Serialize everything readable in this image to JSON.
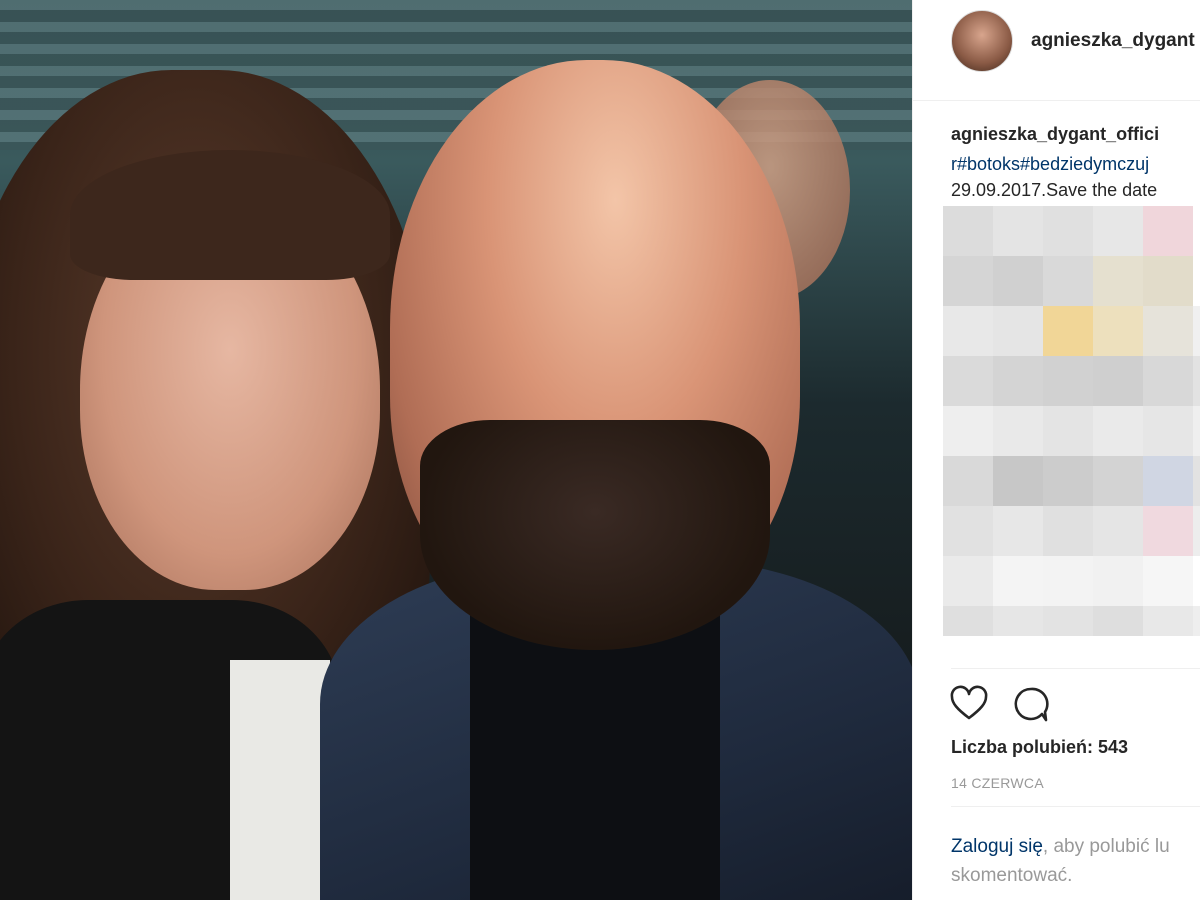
{
  "post": {
    "username": "agnieszka_dygant",
    "caption_username": "agnieszka_dygant_offici",
    "hashtags": "r#botoks#bedziedymczuj",
    "date_line": "29.09.2017.Save the date"
  },
  "actions": {
    "like_icon": "heart-outline-icon",
    "comment_icon": "speech-bubble-icon"
  },
  "likes_text": "Liczba polubień: 543",
  "post_date": "14 CZERWCA",
  "login": {
    "link_text": "Zaloguj się",
    "rest_text": ", aby polubić lu",
    "second_line": "skomentować."
  },
  "blur_colors": [
    "#dcdcdc",
    "#e4e4e4",
    "#e0e0e0",
    "#e7e7e7",
    "#f0d6db",
    "#ffffff",
    "#d5d5d5",
    "#d0d0d0",
    "#d9d9d9",
    "#e5e0cf",
    "#e2dcca",
    "#ffffff",
    "#e8e8e8",
    "#e5e5e5",
    "#f1d697",
    "#ede0bd",
    "#e6e3da",
    "#f0f0f0",
    "#dadada",
    "#d4d4d4",
    "#d1d1d1",
    "#cfcfcf",
    "#d8d8d8",
    "#e2e2e2",
    "#eeeeee",
    "#e9e9e9",
    "#e4e4e4",
    "#eaeaea",
    "#e6e6e6",
    "#efefef",
    "#d9d9d9",
    "#c7c7c7",
    "#cccccc",
    "#d3d3d3",
    "#d0d6e3",
    "#e2e2e2",
    "#e1e1e1",
    "#e7e7e7",
    "#e0e0e0",
    "#e5e5e5",
    "#f0d9df",
    "#ededed",
    "#eaeaea",
    "#f4f4f4",
    "#f3f3f3",
    "#f1f1f1",
    "#f6f6f6",
    "#ffffff",
    "#dfdfdf",
    "#e6e6e6",
    "#e3e3e3",
    "#dedede",
    "#e8e8e8",
    "#eeeeee"
  ]
}
